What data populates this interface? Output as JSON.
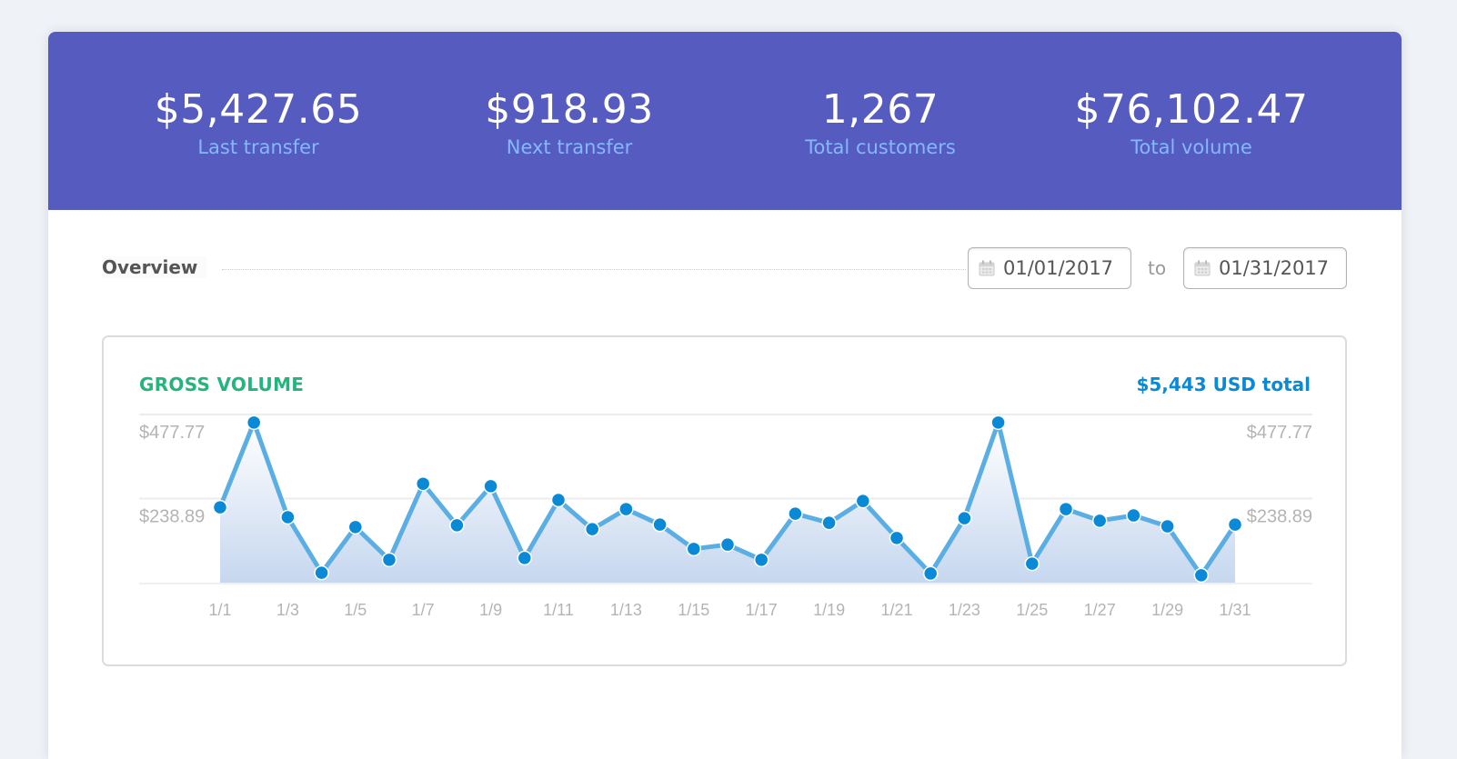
{
  "stats": [
    {
      "value": "$5,427.65",
      "label": "Last transfer"
    },
    {
      "value": "$918.93",
      "label": "Next transfer"
    },
    {
      "value": "1,267",
      "label": "Total customers"
    },
    {
      "value": "$76,102.47",
      "label": "Total volume"
    }
  ],
  "overview": {
    "title": "Overview",
    "date_from": "01/01/2017",
    "to_label": "to",
    "date_to": "01/31/2017",
    "calendar_icon": "calendar-icon"
  },
  "colors": {
    "header_bg": "#555bbf",
    "stat_label": "#86b7ff",
    "chart_title": "#24b47e",
    "chart_total": "#0a8ad6",
    "line": "#5aaee3",
    "point": "#0a8ad6"
  },
  "chart_data": {
    "type": "area",
    "title": "GROSS VOLUME",
    "total_label": "$5,443 USD total",
    "xlabel": "",
    "ylabel": "",
    "ylim": [
      0,
      477.77
    ],
    "y_ticks": [
      238.89,
      477.77
    ],
    "y_tick_labels": [
      "$238.89",
      "$477.77"
    ],
    "y_axis_sides": "both",
    "grid": true,
    "x": [
      "1/1",
      "1/2",
      "1/3",
      "1/4",
      "1/5",
      "1/6",
      "1/7",
      "1/8",
      "1/9",
      "1/10",
      "1/11",
      "1/12",
      "1/13",
      "1/14",
      "1/15",
      "1/16",
      "1/17",
      "1/18",
      "1/19",
      "1/20",
      "1/21",
      "1/22",
      "1/23",
      "1/24",
      "1/25",
      "1/26",
      "1/27",
      "1/28",
      "1/29",
      "1/30",
      "1/31"
    ],
    "x_tick_labels": [
      "1/1",
      "1/3",
      "1/5",
      "1/7",
      "1/9",
      "1/11",
      "1/13",
      "1/15",
      "1/17",
      "1/19",
      "1/21",
      "1/23",
      "1/25",
      "1/27",
      "1/29",
      "1/31"
    ],
    "series": [
      {
        "name": "Gross volume",
        "values": [
          214,
          455,
          186,
          28,
          158,
          65,
          281,
          163,
          274,
          70,
          235,
          152,
          209,
          165,
          96,
          108,
          65,
          196,
          170,
          232,
          127,
          26,
          183,
          455,
          54,
          209,
          176,
          191,
          160,
          21,
          165
        ]
      }
    ]
  }
}
